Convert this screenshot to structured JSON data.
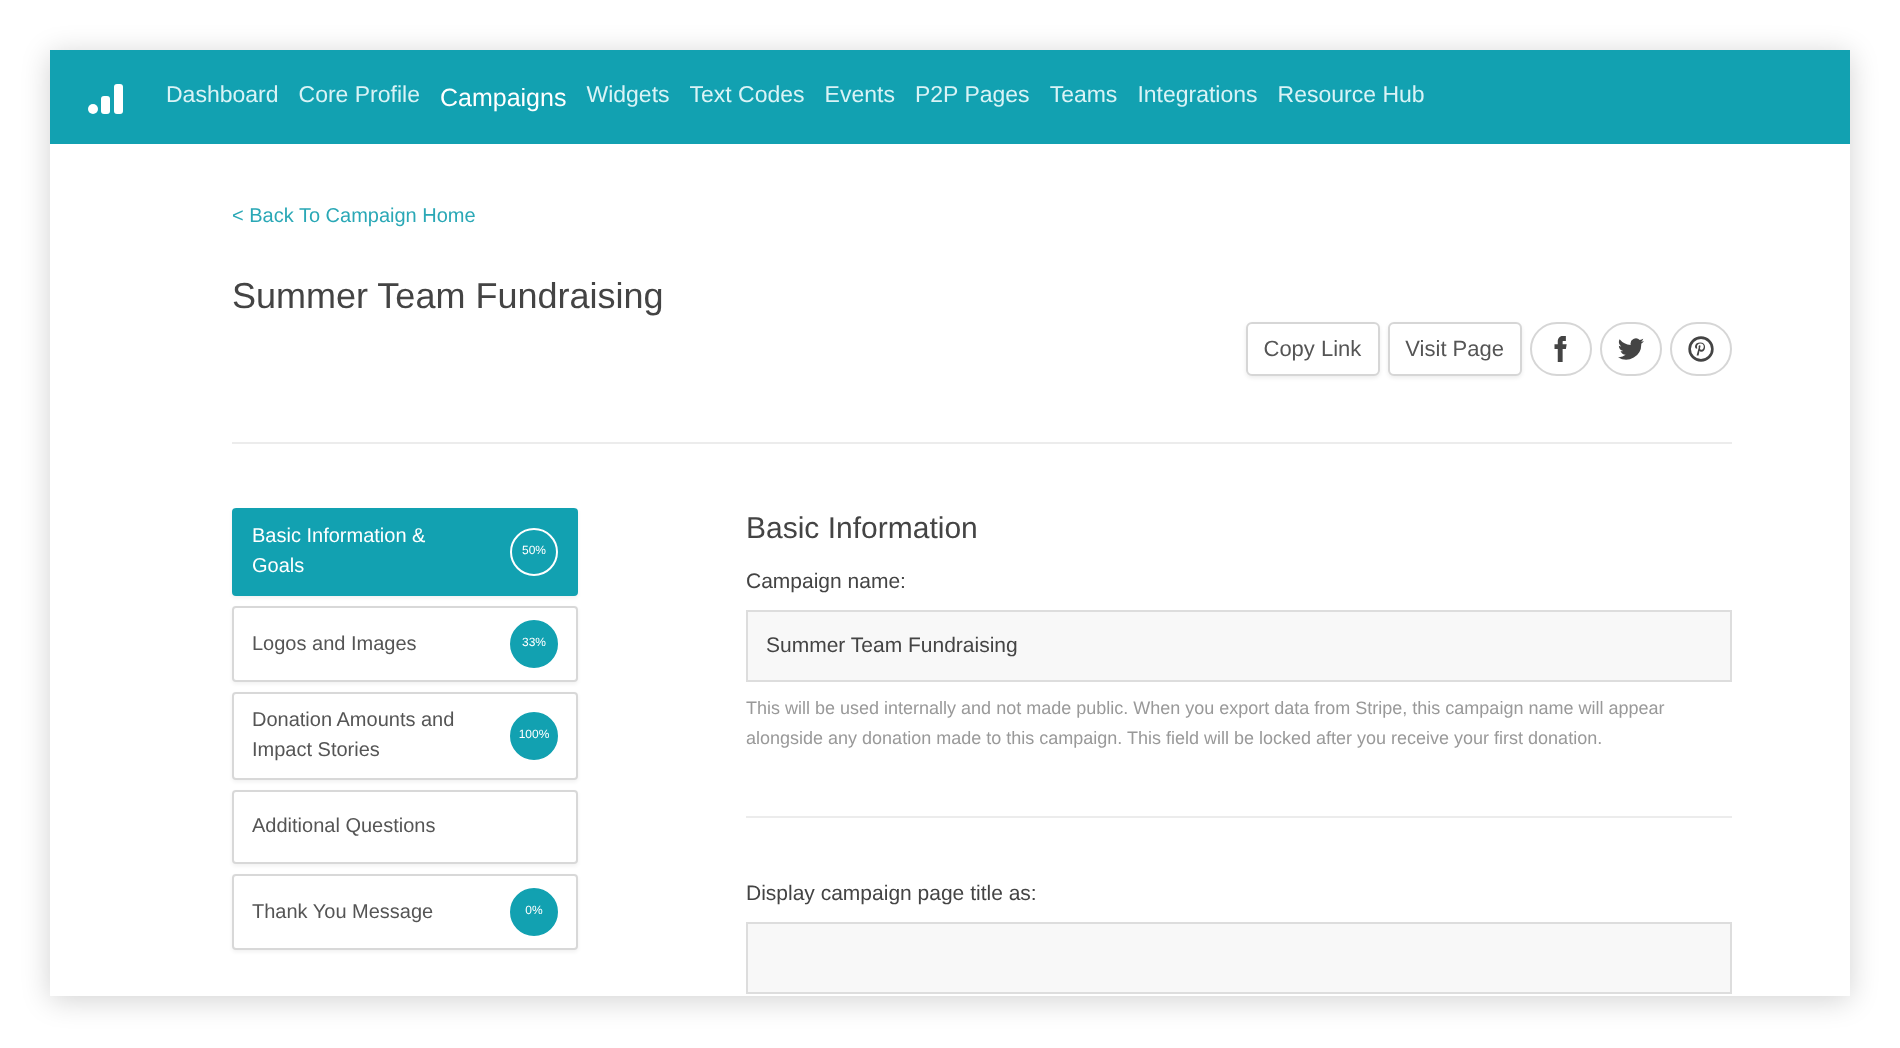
{
  "nav": {
    "items": [
      {
        "label": "Dashboard",
        "selected": false
      },
      {
        "label": "Core Profile",
        "selected": false
      },
      {
        "label": "Campaigns",
        "selected": true
      },
      {
        "label": "Widgets",
        "selected": false
      },
      {
        "label": "Text Codes",
        "selected": false
      },
      {
        "label": "Events",
        "selected": false
      },
      {
        "label": "P2P Pages",
        "selected": false
      },
      {
        "label": "Teams",
        "selected": false
      },
      {
        "label": "Integrations",
        "selected": false
      },
      {
        "label": "Resource Hub",
        "selected": false
      }
    ]
  },
  "back_link": "< Back To Campaign Home",
  "page_title": "Summer Team Fundraising",
  "actions": [
    "Copy Link",
    "Visit Page"
  ],
  "sidebar": {
    "items": [
      {
        "label": "Basic Information & Goals",
        "progress": "50%",
        "selected": true
      },
      {
        "label": "Logos and Images",
        "progress": "33%",
        "selected": false
      },
      {
        "label": "Donation Amounts and Impact Stories",
        "progress": "100%",
        "selected": false
      },
      {
        "label": "Additional Questions",
        "selected": false
      },
      {
        "label": "Thank You Message",
        "progress": "0%",
        "selected": false
      }
    ]
  },
  "section_title": "Basic Information",
  "fields": [
    {
      "label": "Campaign name:",
      "value": "Summer Team Fundraising",
      "help": "This will be used internally and not made public. When you export data from Stripe, this campaign name will appear alongside any donation made to this campaign. This field will be locked after you receive your first donation."
    },
    {
      "label": "Display campaign page title as:"
    }
  ]
}
